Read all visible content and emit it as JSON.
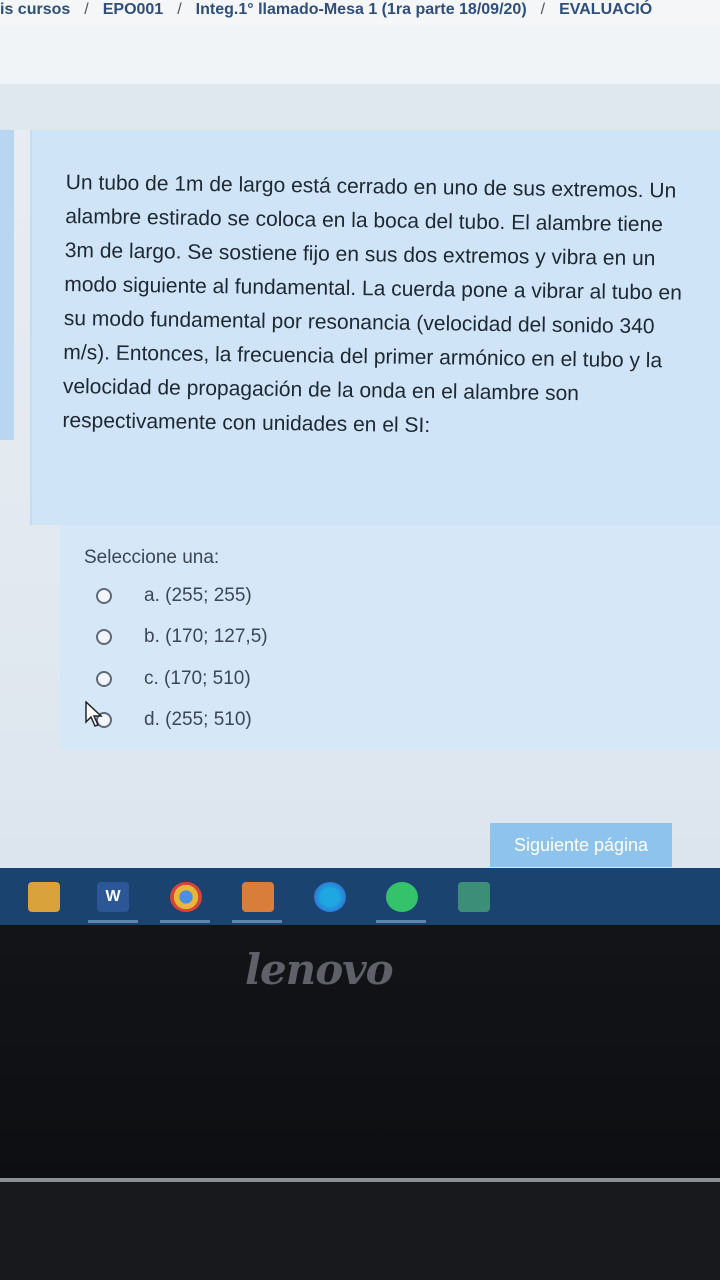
{
  "breadcrumb": {
    "items": [
      "is cursos",
      "EPO001",
      "Integ.1° llamado-Mesa 1 (1ra parte 18/09/20)",
      "EVALUACIÓ"
    ]
  },
  "question": {
    "text": "Un tubo de 1m de largo está cerrado en uno de sus extremos. Un alambre estirado se coloca en la boca del tubo. El alambre tiene 3m de largo. Se sostiene fijo en sus dos extremos y vibra en un modo siguiente al fundamental. La cuerda pone a vibrar al tubo en su modo fundamental por resonancia (velocidad del sonido 340 m/s). Entonces, la frecuencia del primer armónico en el tubo y la velocidad de propagación de la onda en el alambre son respectivamente con unidades en el SI:"
  },
  "answers": {
    "prompt": "Seleccione una:",
    "options": [
      {
        "label": "a. (255; 255)"
      },
      {
        "label": "b. (170; 127,5)"
      },
      {
        "label": "c. (170; 510)"
      },
      {
        "label": "d. (255; 510)"
      }
    ]
  },
  "navigation": {
    "next_label": "Siguiente página"
  },
  "taskbar": {
    "apps": [
      "folder-icon",
      "word-icon",
      "chrome-icon",
      "office-icon",
      "edge-icon",
      "spotify-icon",
      "excel-icon"
    ],
    "word_letter": "W"
  },
  "device": {
    "brand": "lenovo"
  },
  "colors": {
    "accent_button": "#8ec3ee",
    "taskbar": "#1b4370",
    "question_bg": "#cfe4f6"
  }
}
